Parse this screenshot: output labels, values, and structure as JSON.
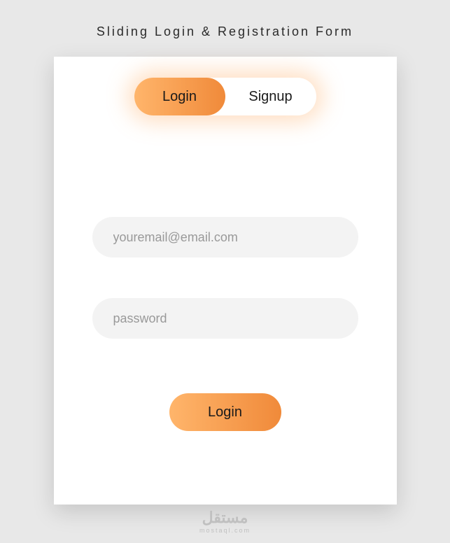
{
  "page": {
    "title": "Sliding Login & Registration Form"
  },
  "tabs": {
    "login": "Login",
    "signup": "Signup"
  },
  "form": {
    "email_placeholder": "youremail@email.com",
    "password_placeholder": "password",
    "submit_label": "Login"
  },
  "watermark": {
    "main": "مستقل",
    "sub": "mostaql.com"
  }
}
